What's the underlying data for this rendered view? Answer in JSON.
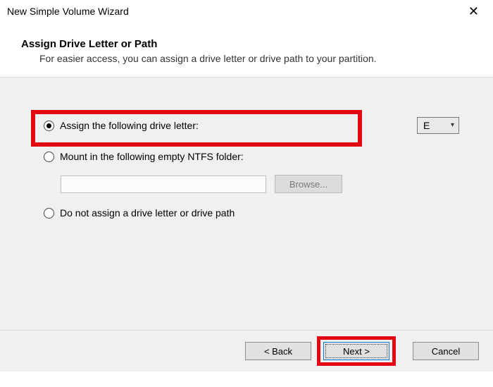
{
  "window": {
    "title": "New Simple Volume Wizard"
  },
  "header": {
    "step_title": "Assign Drive Letter or Path",
    "step_desc": "For easier access, you can assign a drive letter or drive path to your partition."
  },
  "options": {
    "assign_letter": {
      "label": "Assign the following drive letter:",
      "selected": true,
      "drive_value": "E"
    },
    "mount_folder": {
      "label": "Mount in the following empty NTFS folder:",
      "selected": false,
      "path_value": "",
      "browse_label": "Browse..."
    },
    "no_assign": {
      "label": "Do not assign a drive letter or drive path",
      "selected": false
    }
  },
  "buttons": {
    "back": "< Back",
    "next": "Next >",
    "cancel": "Cancel"
  }
}
